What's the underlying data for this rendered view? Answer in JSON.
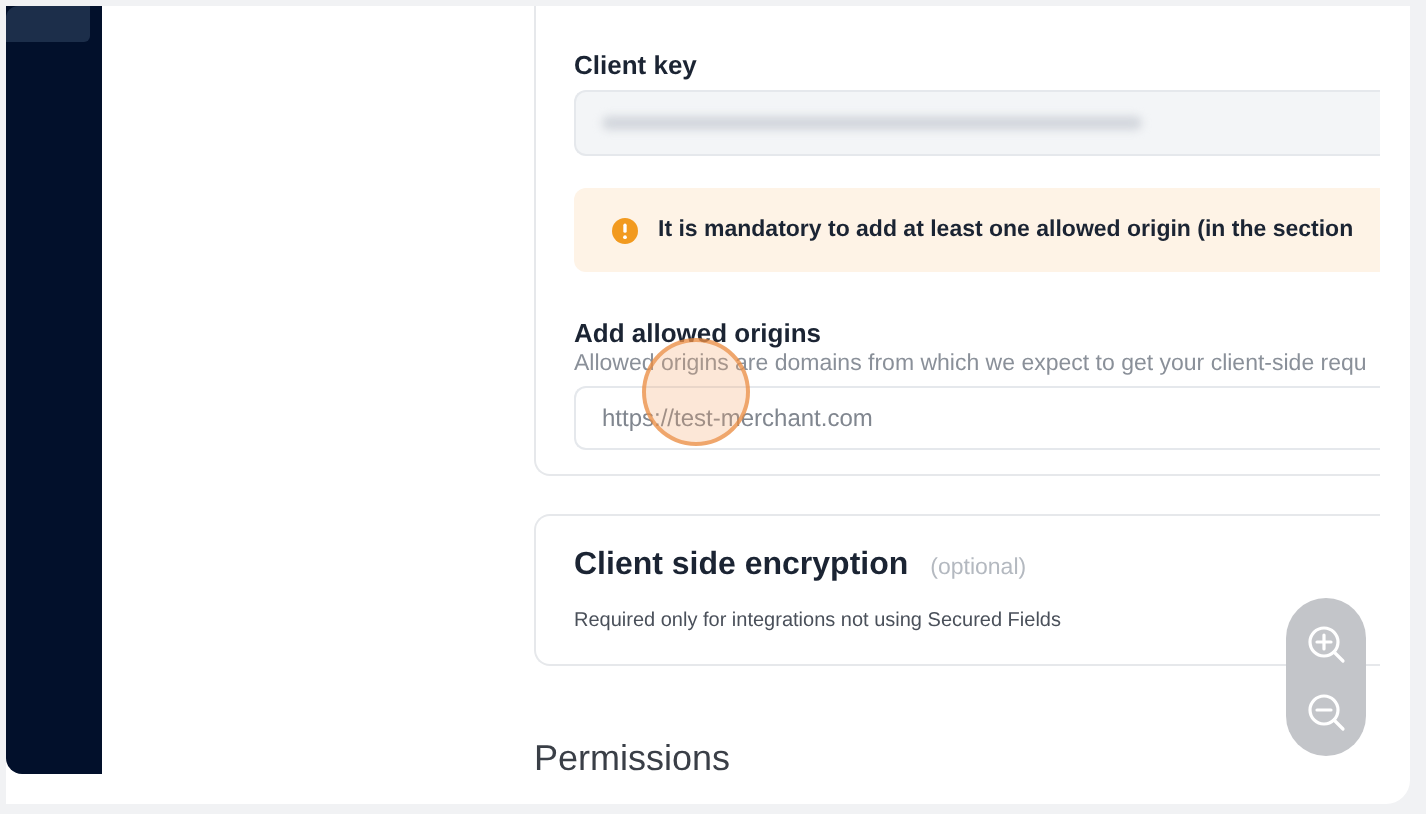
{
  "client_key": {
    "label": "Client key"
  },
  "warning": {
    "text": "It is mandatory to add at least one allowed origin (in the section"
  },
  "allowed_origins": {
    "label": "Add allowed origins",
    "description": "Allowed origins are domains from which we expect to get your client-side requ",
    "placeholder": "https://test-merchant.com"
  },
  "encryption": {
    "title": "Client side encryption",
    "optional": "(optional)",
    "description": "Required only for integrations not using Secured Fields"
  },
  "permissions": {
    "title": "Permissions"
  }
}
